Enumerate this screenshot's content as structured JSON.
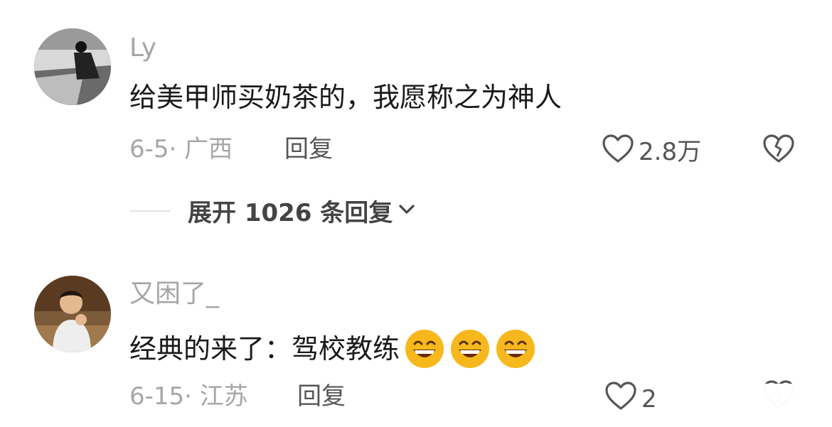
{
  "comments": [
    {
      "username": "Ly",
      "text": "给美甲师买奶茶的，我愿称之为神人",
      "date_location": "6-5· 广西",
      "reply_label": "回复",
      "likes": "2.8万",
      "expand_label": "展开 1026 条回复"
    },
    {
      "username": "又困了_",
      "text": "经典的来了：驾校教练",
      "emoji_count": 3,
      "date_location": "6-15· 江苏",
      "reply_label": "回复",
      "likes": "2"
    }
  ],
  "colors": {
    "muted": "#a6a6a6",
    "text": "#1a1a1a",
    "emoji": "#f6b81c"
  }
}
